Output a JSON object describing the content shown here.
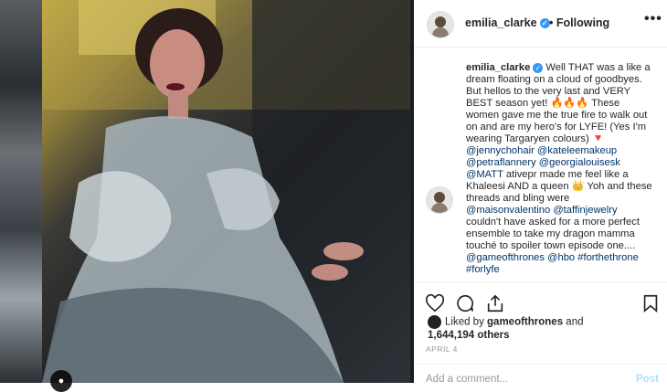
{
  "post": {
    "username": "emilia_clarke",
    "follow_label": "Following",
    "dot": "•",
    "more_label": "•••",
    "next_label": "›",
    "caption_username": "emilia_clarke",
    "caption_segments": [
      {
        "type": "text",
        "text": " Well THAT was a like a dream floating on a cloud of goodbyes. But hellos to the very last and VERY BEST season yet! 🔥🔥🔥 These women gave me the true fire to walk out on and are my hero's for LYFE! (Yes I'm wearing Targaryen colours) 🔻 "
      },
      {
        "type": "mention",
        "text": "@jennychohair"
      },
      {
        "type": "text",
        "text": " "
      },
      {
        "type": "mention",
        "text": "@kateleemakeup"
      },
      {
        "type": "text",
        "text": " "
      },
      {
        "type": "mention",
        "text": "@petraflannery"
      },
      {
        "type": "text",
        "text": " "
      },
      {
        "type": "mention",
        "text": "@georgialouisesk"
      },
      {
        "type": "text",
        "text": " "
      },
      {
        "type": "mention",
        "text": "@MATT"
      },
      {
        "type": "text",
        "text": " ativepr made me feel like a Khaleesi AND a queen 👑 Yoh and these threads and bling were "
      },
      {
        "type": "mention",
        "text": "@maisonvalentino"
      },
      {
        "type": "text",
        "text": " "
      },
      {
        "type": "mention",
        "text": "@taffinjewelry"
      },
      {
        "type": "text",
        "text": " couldn't have asked for a more perfect ensemble to take my dragon mamma touché to spoiler town episode one.... "
      },
      {
        "type": "mention",
        "text": "@gameofthrones"
      },
      {
        "type": "text",
        "text": " "
      },
      {
        "type": "mention",
        "text": "@hbo"
      },
      {
        "type": "text",
        "text": " "
      },
      {
        "type": "mention",
        "text": "#forthethrone"
      },
      {
        "type": "text",
        "text": " "
      },
      {
        "type": "mention",
        "text": "#forlyfe"
      }
    ],
    "liked_by_prefix": "Liked by ",
    "liked_by_user": "gameofthrones",
    "liked_by_and": " and",
    "likes_count": "1,644,194 others",
    "date": "APRIL 4",
    "comment_placeholder": "Add a comment...",
    "post_button": "Post"
  },
  "icons": {
    "heart": "heart-icon",
    "comment": "comment-icon",
    "share": "share-icon",
    "bookmark": "bookmark-icon",
    "verified": "verified-icon",
    "person": "person-tag-icon"
  },
  "colors": {
    "verified": "#3897f0",
    "mention": "#003569",
    "post_button": "#b2dffc"
  }
}
